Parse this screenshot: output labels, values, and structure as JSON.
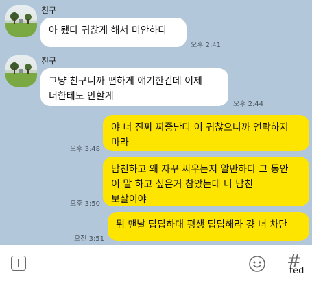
{
  "messages": [
    {
      "sender": "친구",
      "text": "아 됐다 귀찮게 해서 미안하다",
      "time": "오후 2:41"
    },
    {
      "sender": "친구",
      "text": "그냥 친구니까 편하게 얘기한건데 이제\n너한테도 안할게",
      "time": "오후 2:44"
    },
    {
      "text": "야 너 진짜 짜증난다 어 귀찮으니까 연락하지\n마라",
      "time": "오후 3:48"
    },
    {
      "text": "남친하고 왜 자꾸 싸우는지 알만하다 그 동안\n이 말 하고 싶은거 참았는데 니 남친\n보살이야",
      "time": "오후 3:50"
    },
    {
      "text": "뭐 맨날 답답하대 평생 답답해라 걍 너 차단",
      "time": "오전 3:51"
    }
  ],
  "input_bar": {
    "plus_icon": "plus-square-icon",
    "emoji_icon": "smiley-icon",
    "hash_icon": "#"
  },
  "watermark": "ted",
  "colors": {
    "background": "#b2c7d9",
    "incoming_bubble": "#ffffff",
    "outgoing_bubble": "#fee500"
  }
}
